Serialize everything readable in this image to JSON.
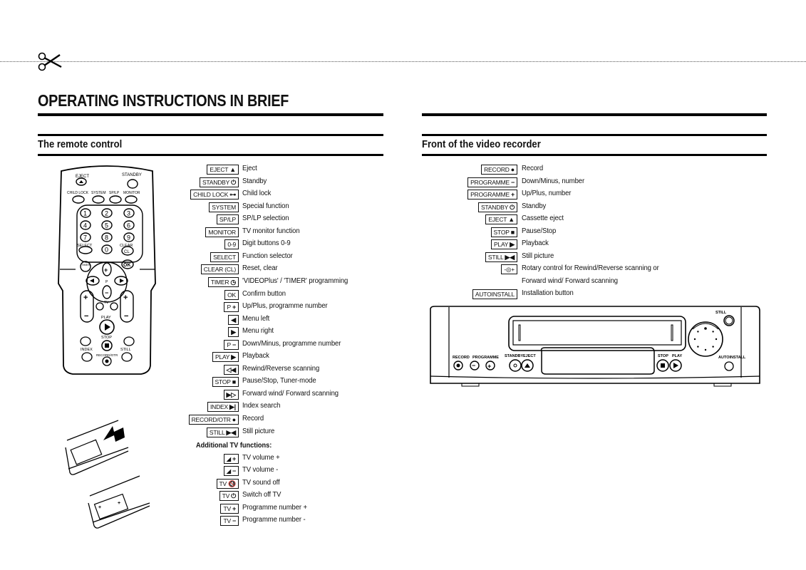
{
  "page": {
    "title": "OPERATING INSTRUCTIONS IN BRIEF",
    "cut_marker_icon": "scissors-icon"
  },
  "remote": {
    "section_title": "The remote control",
    "keys": [
      {
        "key": "EJECT",
        "symbol": "▲",
        "icon": "eject-icon",
        "desc": "Eject"
      },
      {
        "key": "STANDBY",
        "symbol": "⏻",
        "icon": "power-icon",
        "desc": "Standby"
      },
      {
        "key": "CHILD LOCK",
        "symbol": "⊶",
        "icon": "key-icon",
        "desc": "Child lock"
      },
      {
        "key": "SYSTEM",
        "symbol": "",
        "icon": "",
        "desc": "Special function"
      },
      {
        "key": "SP/LP",
        "symbol": "",
        "icon": "",
        "desc": "SP/LP selection"
      },
      {
        "key": "MONITOR",
        "symbol": "",
        "icon": "",
        "desc": "TV monitor function"
      },
      {
        "key": "0-9",
        "symbol": "",
        "icon": "",
        "desc": "Digit buttons 0-9"
      },
      {
        "key": "SELECT",
        "symbol": "",
        "icon": "",
        "desc": "Function selector"
      },
      {
        "key": "CLEAR (CL)",
        "symbol": "",
        "icon": "",
        "desc": "Reset, clear"
      },
      {
        "key": "TIMER",
        "symbol": "◷",
        "icon": "clock-icon",
        "desc": "'VIDEOPlus' / 'TIMER' programming"
      },
      {
        "key": "OK",
        "symbol": "",
        "icon": "",
        "desc": "Confirm button"
      },
      {
        "key": "P",
        "symbol": "+",
        "icon": "plus-icon",
        "desc": "Up/Plus, programme number"
      },
      {
        "key": "",
        "symbol": "◀",
        "icon": "arrow-left-icon",
        "desc": "Menu left"
      },
      {
        "key": "",
        "symbol": "▶",
        "icon": "arrow-right-icon",
        "desc": "Menu right"
      },
      {
        "key": "P",
        "symbol": "−",
        "icon": "minus-icon",
        "desc": "Down/Minus, programme number"
      },
      {
        "key": "PLAY",
        "symbol": "▶",
        "icon": "play-icon",
        "desc": "Playback"
      },
      {
        "key": "",
        "symbol": "◁◀",
        "icon": "rewind-icon",
        "desc": "Rewind/Reverse scanning"
      },
      {
        "key": "STOP",
        "symbol": "■",
        "icon": "stop-icon",
        "desc": "Pause/Stop, Tuner-mode"
      },
      {
        "key": "",
        "symbol": "▶▷",
        "icon": "fast-forward-icon",
        "desc": "Forward wind/ Forward scanning"
      },
      {
        "key": "INDEX",
        "symbol": "▶|",
        "icon": "index-icon",
        "desc": "Index search"
      },
      {
        "key": "RECORD/OTR",
        "symbol": "●",
        "icon": "record-icon",
        "desc": "Record"
      },
      {
        "key": "STILL",
        "symbol": "▶◀",
        "icon": "still-icon",
        "desc": "Still picture"
      }
    ],
    "additional_heading": "Additional TV functions:",
    "tv_keys": [
      {
        "key": "◢",
        "symbol": "+",
        "icon": "volume-up-icon",
        "desc": "TV volume +"
      },
      {
        "key": "◢",
        "symbol": "−",
        "icon": "volume-down-icon",
        "desc": "TV volume -"
      },
      {
        "key": "TV",
        "symbol": "🔇",
        "icon": "mute-icon",
        "desc": "TV sound off"
      },
      {
        "key": "TV",
        "symbol": "⏻",
        "icon": "power-icon",
        "desc": "Switch off TV"
      },
      {
        "key": "TV",
        "symbol": "+",
        "icon": "plus-icon",
        "desc": "Programme number +"
      },
      {
        "key": "TV",
        "symbol": "−",
        "icon": "minus-icon",
        "desc": "Programme number -"
      }
    ],
    "illustration_labels": {
      "eject": "EJECT",
      "standby": "STANDBY",
      "child_lock": "CHILD LOCK",
      "system": "SYSTEM",
      "sp_lp": "SP/LP",
      "monitor": "MONITOR",
      "select": "SELECT",
      "clear": "CLEAR",
      "cl": "CL",
      "timer": "TIMER",
      "ok": "OK",
      "p": "P",
      "tv": "TV",
      "play": "PLAY",
      "stop": "STOP",
      "index": "INDEX",
      "still": "STILL",
      "record": "RECORD/OTR",
      "digits": [
        "1",
        "2",
        "3",
        "4",
        "5",
        "6",
        "7",
        "8",
        "9",
        "0"
      ]
    }
  },
  "recorder": {
    "section_title": "Front of the video recorder",
    "keys": [
      {
        "key": "RECORD",
        "symbol": "●",
        "icon": "record-icon",
        "desc": "Record"
      },
      {
        "key": "PROGRAMME",
        "symbol": "−",
        "icon": "minus-icon",
        "desc": "Down/Minus, number"
      },
      {
        "key": "PROGRAMME",
        "symbol": "+",
        "icon": "plus-icon",
        "desc": "Up/Plus, number"
      },
      {
        "key": "STANDBY",
        "symbol": "⏻",
        "icon": "power-icon",
        "desc": "Standby"
      },
      {
        "key": "EJECT",
        "symbol": "▲",
        "icon": "eject-icon",
        "desc": "Cassette eject"
      },
      {
        "key": "STOP",
        "symbol": "■",
        "icon": "stop-icon",
        "desc": "Pause/Stop"
      },
      {
        "key": "PLAY",
        "symbol": "▶",
        "icon": "play-icon",
        "desc": "Playback"
      },
      {
        "key": "STILL",
        "symbol": "▶◀",
        "icon": "still-icon",
        "desc": "Still picture"
      },
      {
        "key": "-◎+",
        "symbol": "",
        "icon": "rotary-icon",
        "desc": "Rotary control for Rewind/Reverse scanning or"
      },
      {
        "key": "",
        "symbol": "",
        "icon": "",
        "desc": "Forward wind/ Forward scanning",
        "continuation": true
      },
      {
        "key": "AUTOINSTALL",
        "symbol": "",
        "icon": "",
        "desc": "Installation button"
      }
    ],
    "illustration_labels": {
      "record": "RECORD",
      "programme": "PROGRAMME",
      "standby": "STANDBY",
      "eject": "EJECT",
      "stop": "STOP",
      "play": "PLAY",
      "still": "STILL",
      "autoinstall": "AUTOINSTALL"
    }
  }
}
